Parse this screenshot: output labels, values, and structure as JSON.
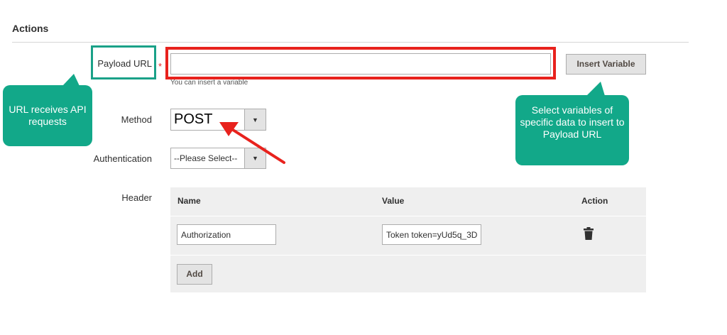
{
  "section": {
    "title": "Actions"
  },
  "payload": {
    "label": "Payload URL",
    "required_mark": "*",
    "value": "",
    "hint": "You can insert a variable",
    "insert_button": "Insert Variable"
  },
  "method": {
    "label": "Method",
    "selected": "POST"
  },
  "authentication": {
    "label": "Authentication",
    "selected": "--Please Select--"
  },
  "header": {
    "label": "Header",
    "columns": [
      "Name",
      "Value",
      "Action"
    ],
    "rows": [
      {
        "name": "Authorization",
        "value": "Token token=yUd5q_3D"
      }
    ],
    "add_button": "Add"
  },
  "annotations": {
    "left_callout": "URL receives API requests",
    "right_callout": "Select variables of specific data to insert to Payload URL"
  },
  "colors": {
    "callout": "#12a889",
    "highlight_teal": "#1aa188",
    "highlight_red": "#e8221d",
    "required": "#e22626"
  },
  "icons": {
    "dropdown": "triangle-down",
    "delete": "trash"
  }
}
